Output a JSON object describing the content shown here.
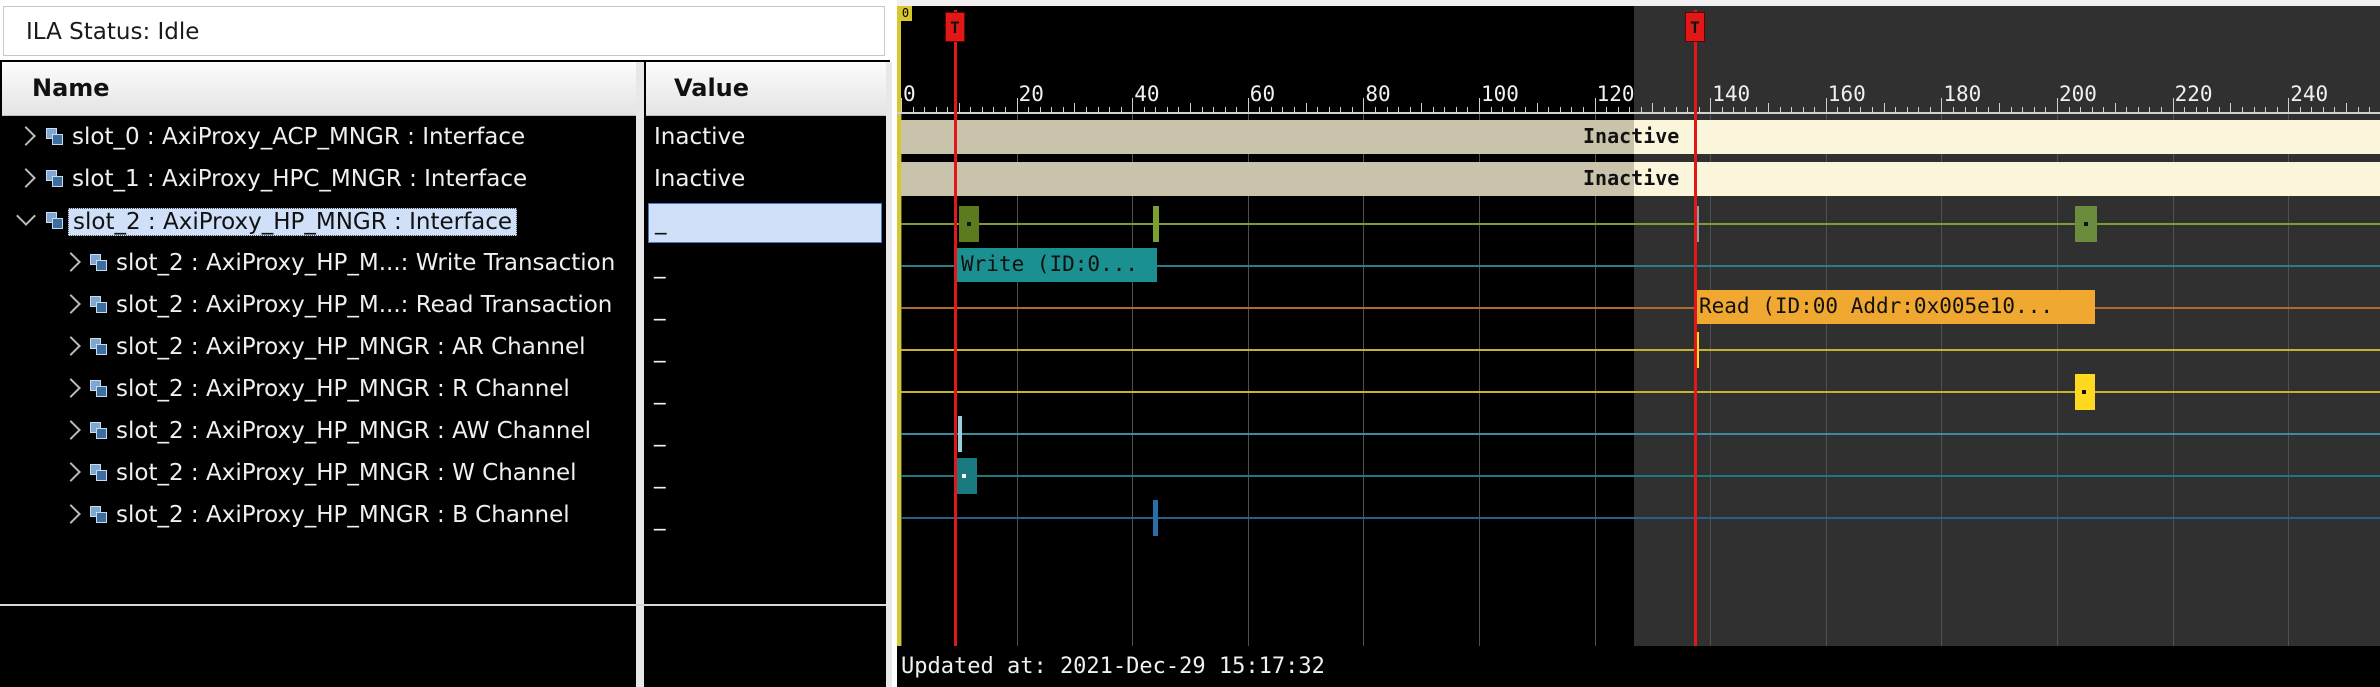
{
  "status": {
    "text": "ILA Status: Idle"
  },
  "table": {
    "name_header": "Name",
    "value_header": "Value",
    "rows": [
      {
        "label": "slot_0 : AxiProxy_ACP_MNGR : Interface",
        "value": "Inactive"
      },
      {
        "label": "slot_1 : AxiProxy_HPC_MNGR : Interface",
        "value": "Inactive"
      },
      {
        "label": "slot_2 : AxiProxy_HP_MNGR : Interface",
        "value": "_"
      },
      {
        "label": "slot_2 : AxiProxy_HP_M...: Write Transaction",
        "value": "_"
      },
      {
        "label": "slot_2 : AxiProxy_HP_M...: Read Transaction",
        "value": "_"
      },
      {
        "label": "slot_2 : AxiProxy_HP_MNGR : AR Channel",
        "value": "_"
      },
      {
        "label": "slot_2 : AxiProxy_HP_MNGR : R Channel",
        "value": "_"
      },
      {
        "label": "slot_2 : AxiProxy_HP_MNGR : AW Channel",
        "value": "_"
      },
      {
        "label": "slot_2 : AxiProxy_HP_MNGR : W Channel",
        "value": "_"
      },
      {
        "label": "slot_2 : AxiProxy_HP_MNGR : B Channel",
        "value": "_"
      }
    ]
  },
  "waveform": {
    "origin_marker": "0",
    "ruler_labels": [
      "0",
      "20",
      "40",
      "60",
      "80",
      "100",
      "120",
      "140",
      "160",
      "180",
      "200",
      "220",
      "240"
    ],
    "cursor_label": "T",
    "bus_labels": [
      "Inactive",
      "Inactive"
    ],
    "write_transaction": "Write (ID:0...",
    "read_transaction": "Read (ID:00 Addr:0x005e10...",
    "updated_at": "Updated at: 2021-Dec-29 15:17:32"
  },
  "colors": {
    "cursor": "#e01818",
    "write": "#1a9090",
    "read": "#f0a830",
    "selection": "#cfe0f8"
  },
  "icons": [
    "chevron-right-icon",
    "chevron-down-icon",
    "interface-icon"
  ]
}
